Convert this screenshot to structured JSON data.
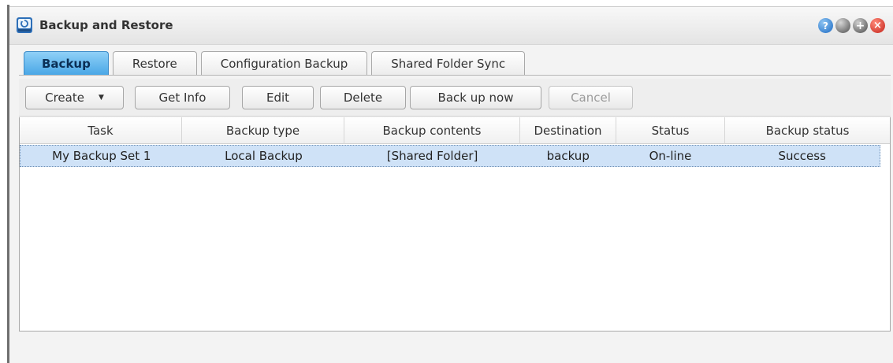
{
  "window": {
    "title": "Backup and Restore"
  },
  "tabs": [
    {
      "label": "Backup",
      "active": true
    },
    {
      "label": "Restore",
      "active": false
    },
    {
      "label": "Configuration Backup",
      "active": false
    },
    {
      "label": "Shared Folder Sync",
      "active": false
    }
  ],
  "toolbar": {
    "create": "Create",
    "get_info": "Get Info",
    "edit": "Edit",
    "delete": "Delete",
    "back_up_now": "Back up now",
    "cancel": "Cancel"
  },
  "table": {
    "columns": [
      "Task",
      "Backup type",
      "Backup contents",
      "Destination",
      "Status",
      "Backup status"
    ],
    "rows": [
      [
        "My Backup Set 1",
        "Local Backup",
        "[Shared Folder]",
        "backup",
        "On-line",
        "Success"
      ]
    ]
  },
  "colors": {
    "accent_tab": "#4aa7e6",
    "selected_row": "#cfe2f7"
  },
  "icons": [
    "backup-app-icon",
    "help-icon",
    "minimize-icon",
    "maximize-icon",
    "close-icon",
    "dropdown-caret-icon"
  ]
}
